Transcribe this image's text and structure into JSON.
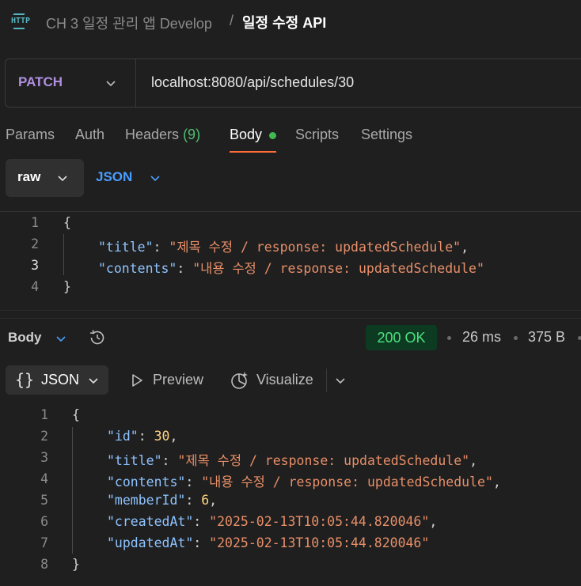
{
  "breadcrumb": {
    "icon": "http-icon",
    "collection": "CH 3 일정 관리 앱 Develop",
    "separator": "/",
    "request": "일정 수정 API"
  },
  "request": {
    "method": "PATCH",
    "method_color": "#b18fe0",
    "url": "localhost:8080/api/schedules/30"
  },
  "tabs": [
    {
      "label": "Params"
    },
    {
      "label": "Auth"
    },
    {
      "label": "Headers",
      "count": "(9)"
    },
    {
      "label": "Body",
      "active": true,
      "indicator": "green-dot"
    },
    {
      "label": "Scripts"
    },
    {
      "label": "Settings"
    }
  ],
  "body_mode": {
    "type": "raw",
    "language": "JSON"
  },
  "request_body": {
    "line_numbers": [
      "1",
      "2",
      "3",
      "4"
    ],
    "open_brace": "{",
    "close_brace": "}",
    "lines": [
      {
        "key": "\"title\"",
        "colon": ": ",
        "value": "\"제목 수정 / response: updatedSchedule\"",
        "trail": ","
      },
      {
        "key": "\"contents\"",
        "colon": ": ",
        "value": "\"내용 수정 / response: updatedSchedule\"",
        "trail": ""
      }
    ]
  },
  "response": {
    "section_label": "Body",
    "history_icon": "history-icon",
    "status": "200 OK",
    "status_color": "#4ce07f",
    "time": "26 ms",
    "size": "375 B",
    "format": "JSON",
    "format_icon": "braces-icon",
    "preview_label": "Preview",
    "visualize_label": "Visualize"
  },
  "response_body": {
    "line_numbers": [
      "1",
      "2",
      "3",
      "4",
      "5",
      "6",
      "7",
      "8"
    ],
    "open_brace": "{",
    "close_brace": "}",
    "lines": [
      {
        "key": "\"id\"",
        "colon": ": ",
        "value": "30",
        "trail": ",",
        "kind": "number"
      },
      {
        "key": "\"title\"",
        "colon": ": ",
        "value": "\"제목 수정 / response: updatedSchedule\"",
        "trail": ",",
        "kind": "string"
      },
      {
        "key": "\"contents\"",
        "colon": ": ",
        "value": "\"내용 수정 / response: updatedSchedule\"",
        "trail": ",",
        "kind": "string"
      },
      {
        "key": "\"memberId\"",
        "colon": ": ",
        "value": "6",
        "trail": ",",
        "kind": "number"
      },
      {
        "key": "\"createdAt\"",
        "colon": ": ",
        "value": "\"2025-02-13T10:05:44.820046\"",
        "trail": ",",
        "kind": "string"
      },
      {
        "key": "\"updatedAt\"",
        "colon": ": ",
        "value": "\"2025-02-13T10:05:44.820046\"",
        "trail": "",
        "kind": "string"
      }
    ]
  },
  "colors": {
    "background": "#1f1f1f",
    "accent_tab": "#ff6c37",
    "link_blue": "#4a9eff",
    "json_key": "#8ec3ff",
    "json_string": "#e88f68",
    "json_number": "#ffd580"
  }
}
